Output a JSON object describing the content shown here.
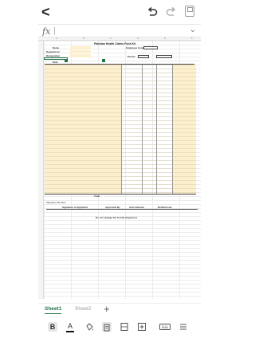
{
  "toolbar": {
    "back_glyph": "<",
    "undo_icon": "undo-icon",
    "redo_icon": "redo-icon",
    "save_icon": "save-icon"
  },
  "formula_bar": {
    "fx_label": "fx",
    "value": ""
  },
  "sheet": {
    "title": "Pakistan Health Claims Fund Kit",
    "labels": {
      "name": "Name",
      "employee_code": "Employee Code",
      "department": "Department",
      "designation": "Designation",
      "date": "Date",
      "period": "Period",
      "total": "Total",
      "signature_member": "Signature Member",
      "signature_applicant": "Signature of Applicant",
      "approved_by": "Approved By",
      "amount_advance": "Amt Advance",
      "reimbursed": "Reimbursed",
      "footer_note": "Do not change the format Alignment"
    },
    "colors": {
      "input_fill": "#fcefce",
      "selection": "#217346",
      "grid": "#ececec"
    }
  },
  "tabs": {
    "active": "Sheet1",
    "inactive": "Sheet2",
    "add_label": "+"
  },
  "bottom_toolbar": {
    "bold_label": "B",
    "font_color_label": "A",
    "icons": [
      "bold-icon",
      "font-color-icon",
      "fill-color-icon",
      "align-icon",
      "merge-cells-icon",
      "insert-cells-icon",
      "keyboard-icon",
      "menu-icon"
    ]
  }
}
